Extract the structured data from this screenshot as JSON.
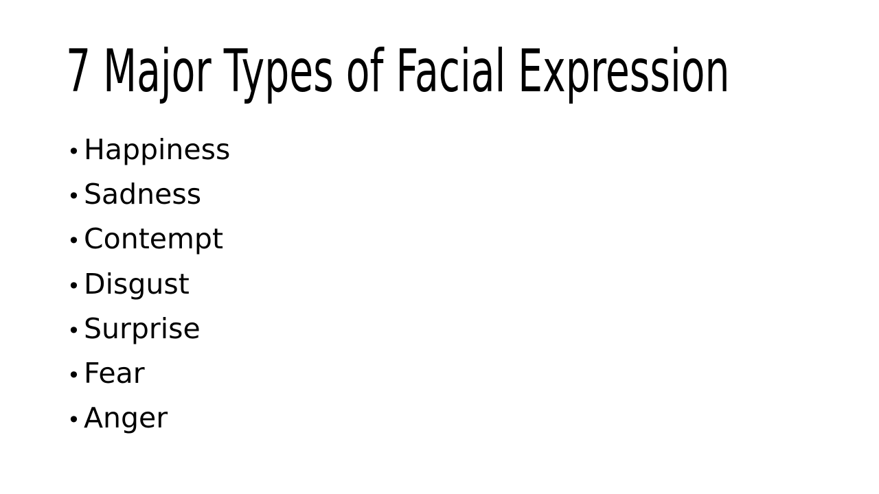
{
  "slide": {
    "title": "7 Major Types of Facial Expression",
    "bullets": [
      "Happiness",
      "Sadness",
      "Contempt",
      "Disgust",
      "Surprise",
      "Fear",
      "Anger"
    ],
    "bullet_glyph": "•",
    "colors": {
      "background": "#ffffff",
      "text": "#000000"
    }
  }
}
